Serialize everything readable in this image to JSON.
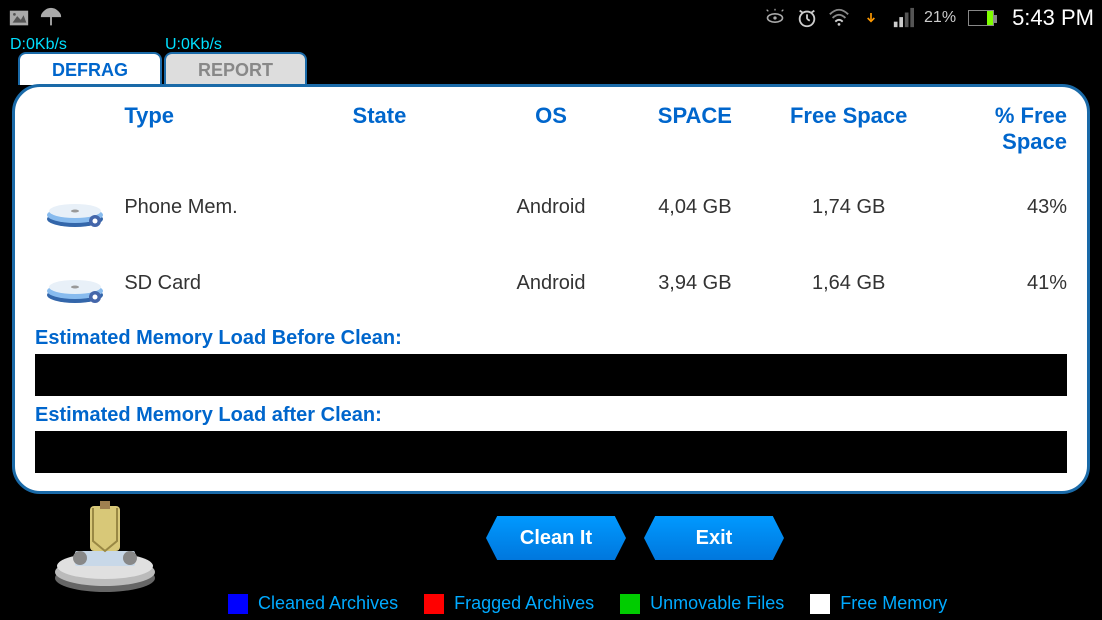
{
  "status": {
    "download": "D:0Kb/s",
    "upload": "U:0Kb/s",
    "battery_pct": "21%",
    "clock": "5:43 PM"
  },
  "tabs": {
    "defrag": "DEFRAG",
    "report": "REPORT"
  },
  "headers": {
    "type": "Type",
    "state": "State",
    "os": "OS",
    "space": "SPACE",
    "free": "Free Space",
    "pct": "% Free Space"
  },
  "rows": [
    {
      "type": "Phone Mem.",
      "state": "",
      "os": "Android",
      "space": "4,04 GB",
      "free": "1,74 GB",
      "pct": "43%"
    },
    {
      "type": "SD Card",
      "state": "",
      "os": "Android",
      "space": "3,94 GB",
      "free": "1,64 GB",
      "pct": "41%"
    }
  ],
  "labels": {
    "before": "Estimated Memory Load Before Clean:",
    "after": "Estimated Memory Load after Clean:"
  },
  "buttons": {
    "clean": "Clean It",
    "exit": "Exit"
  },
  "legend": [
    {
      "color": "#0000ff",
      "label": "Cleaned Archives"
    },
    {
      "color": "#ff0000",
      "label": "Fragged Archives"
    },
    {
      "color": "#00cc00",
      "label": "Unmovable Files"
    },
    {
      "color": "#ffffff",
      "label": "Free Memory"
    }
  ]
}
